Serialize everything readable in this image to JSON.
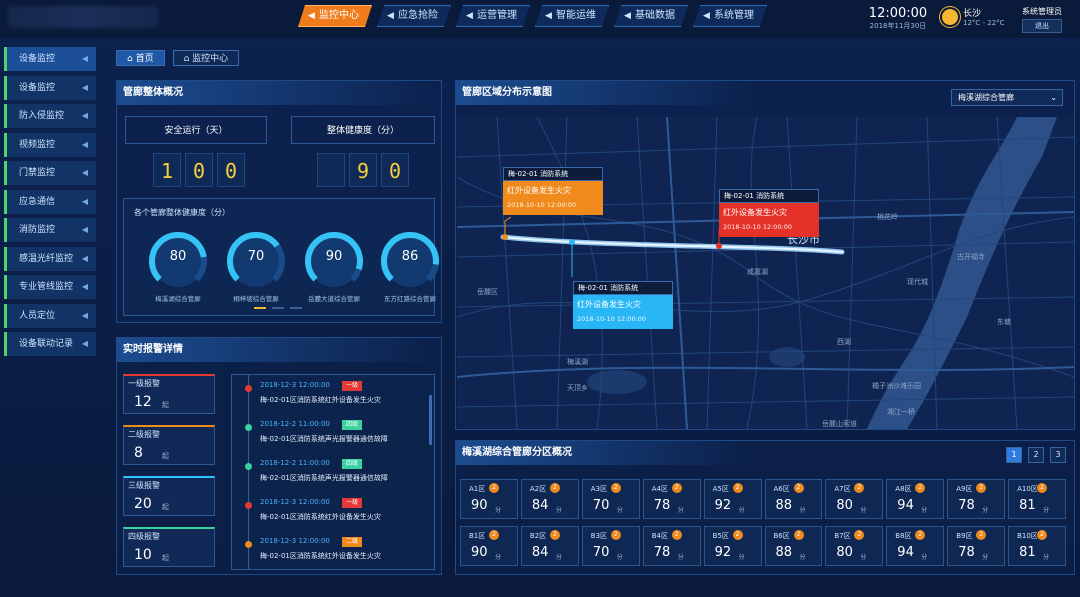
{
  "nav": [
    {
      "label": "监控中心",
      "active": true
    },
    {
      "label": "应急抢险",
      "active": false
    },
    {
      "label": "运营管理",
      "active": false
    },
    {
      "label": "智能运维",
      "active": false
    },
    {
      "label": "基础数据",
      "active": false
    },
    {
      "label": "系统管理",
      "active": false
    }
  ],
  "header": {
    "time": "12:00:00",
    "date": "2018年11月30日",
    "city": "长沙",
    "temp": "12°C - 22°C",
    "user": "系统管理员",
    "logout": "退出"
  },
  "sidebar": [
    {
      "label": "设备监控",
      "active": true
    },
    {
      "label": "设备监控",
      "active": false
    },
    {
      "label": "防入侵监控",
      "active": false
    },
    {
      "label": "视频监控",
      "active": false
    },
    {
      "label": "门禁监控",
      "active": false
    },
    {
      "label": "应急通信",
      "active": false
    },
    {
      "label": "消防监控",
      "active": false
    },
    {
      "label": "感温光纤监控",
      "active": false
    },
    {
      "label": "专业管线监控",
      "active": false
    },
    {
      "label": "人员定位",
      "active": false
    },
    {
      "label": "设备联动记录",
      "active": false
    }
  ],
  "tabs": [
    {
      "label": "首页",
      "active": true
    },
    {
      "label": "监控中心",
      "active": false
    }
  ],
  "overview": {
    "title": "管廊整体概况",
    "safe_label": "安全运行（天）",
    "safe_digits": [
      "1",
      "0",
      "0"
    ],
    "health_label": "整体健康度（分）",
    "health_digits": [
      "",
      "9",
      "0"
    ],
    "gauge_title": "各个管廊整体健康度（分）",
    "gauges": [
      {
        "value": 80,
        "name": "梅溪湖综合管廊"
      },
      {
        "value": 70,
        "name": "桐梓坡综合管廊"
      },
      {
        "value": 90,
        "name": "岳麓大道综合管廊"
      },
      {
        "value": 86,
        "name": "东方红路综合管廊"
      }
    ]
  },
  "alarms": {
    "title": "实时报警详情",
    "unit": "起",
    "levels": [
      {
        "name": "一级报警",
        "count": "12",
        "color": "#e53935"
      },
      {
        "name": "二级报警",
        "count": "8",
        "color": "#f08a1c"
      },
      {
        "name": "三级报警",
        "count": "20",
        "color": "#29c5f6"
      },
      {
        "name": "四级报警",
        "count": "10",
        "color": "#3ad29f"
      }
    ],
    "events": [
      {
        "time": "2018-12-3  12:00:00",
        "badge": "一级",
        "color": "#e53935",
        "desc": "梅-02-01区消防系统红外设备发生火灾"
      },
      {
        "time": "2018-12-2  11:00:00",
        "badge": "四级",
        "color": "#3ad29f",
        "desc": "梅-02-01区消防系统声光报警器通信故障"
      },
      {
        "time": "2018-12-2  11:00:00",
        "badge": "四级",
        "color": "#3ad29f",
        "desc": "梅-02-01区消防系统声光报警器通信故障"
      },
      {
        "time": "2018-12-3  12:00:00",
        "badge": "一级",
        "color": "#e53935",
        "desc": "梅-02-01区消防系统红外设备发生火灾"
      },
      {
        "time": "2018-12-3  12:00:00",
        "badge": "二级",
        "color": "#f08a1c",
        "desc": "梅-02-01区消防系统红外设备发生火灾"
      }
    ]
  },
  "map": {
    "title": "管廊区域分布示意图",
    "select": "梅溪湖综合管廊",
    "city": "长沙市",
    "labels": [
      "岳麓区",
      "西湖",
      "咸嘉湖",
      "梅溪湖",
      "天顶乡",
      "橘子洲沙滩乐园",
      "古开福寺",
      "湘江一桥",
      "桃花岭",
      "现代城",
      "岳麓山索道",
      "东塘"
    ],
    "callouts": [
      {
        "head": "梅-02-01  消防系统",
        "title": "红外设备发生火灾",
        "time": "2018-10-10 12:00:00",
        "color": "#f08a1c"
      },
      {
        "head": "梅-02-01  消防系统",
        "title": "红外设备发生火灾",
        "time": "2018-10-10 12:00:00",
        "color": "#e53229"
      },
      {
        "head": "梅-02-01  消防系统",
        "title": "红外设备发生火灾",
        "time": "2018-10-10 12:00:00",
        "color": "#29b6f6"
      }
    ]
  },
  "zones": {
    "title": "梅溪湖综合管廊分区概况",
    "pages": [
      "1",
      "2",
      "3"
    ],
    "unit": "分",
    "rowA": [
      {
        "name": "A1区",
        "badge": "2",
        "value": "90"
      },
      {
        "name": "A2区",
        "badge": "2",
        "value": "84"
      },
      {
        "name": "A3区",
        "badge": "2",
        "value": "70"
      },
      {
        "name": "A4区",
        "badge": "2",
        "value": "78"
      },
      {
        "name": "A5区",
        "badge": "2",
        "value": "92"
      },
      {
        "name": "A6区",
        "badge": "2",
        "value": "88"
      },
      {
        "name": "A7区",
        "badge": "2",
        "value": "80"
      },
      {
        "name": "A8区",
        "badge": "2",
        "value": "94"
      },
      {
        "name": "A9区",
        "badge": "2",
        "value": "78"
      },
      {
        "name": "A10区",
        "badge": "2",
        "value": "81"
      }
    ],
    "rowB": [
      {
        "name": "B1区",
        "badge": "2",
        "value": "90"
      },
      {
        "name": "B2区",
        "badge": "2",
        "value": "84"
      },
      {
        "name": "B3区",
        "badge": "2",
        "value": "70"
      },
      {
        "name": "B4区",
        "badge": "2",
        "value": "78"
      },
      {
        "name": "B5区",
        "badge": "2",
        "value": "92"
      },
      {
        "name": "B6区",
        "badge": "2",
        "value": "88"
      },
      {
        "name": "B7区",
        "badge": "2",
        "value": "80"
      },
      {
        "name": "B8区",
        "badge": "2",
        "value": "94"
      },
      {
        "name": "B9区",
        "badge": "2",
        "value": "78"
      },
      {
        "name": "B10区",
        "badge": "2",
        "value": "81"
      }
    ]
  }
}
